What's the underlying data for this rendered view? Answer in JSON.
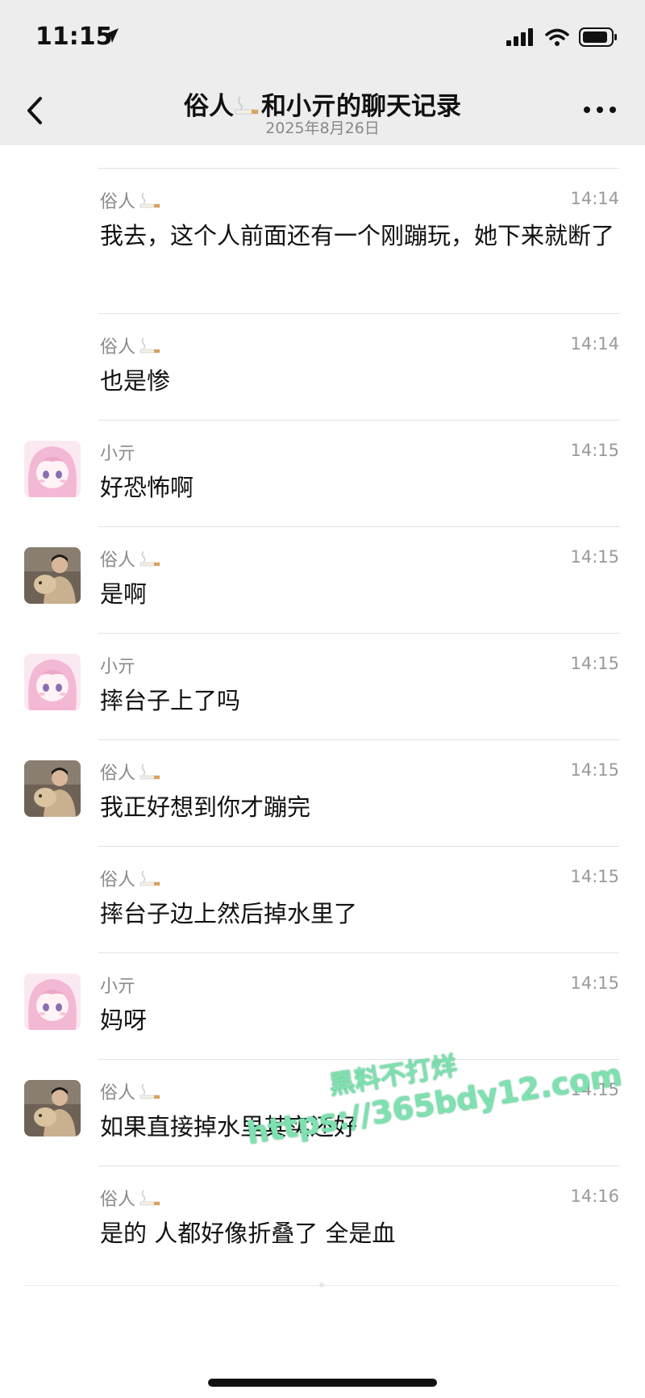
{
  "status_bar": {
    "time": "11:15"
  },
  "header": {
    "title_part1": "俗人",
    "title_part2": "和小亓的聊天记录",
    "date": "2025年8月26日"
  },
  "messages": [
    {
      "sender": "俗人",
      "emoji": true,
      "avatar": "none",
      "time": "14:14",
      "text": "我去，这个人前面还有一个刚蹦玩，她下来就断了"
    },
    {
      "sender": "俗人",
      "emoji": true,
      "avatar": "none",
      "time": "14:14",
      "text": "也是惨"
    },
    {
      "sender": "小亓",
      "emoji": false,
      "avatar": "anime",
      "time": "14:15",
      "text": "好恐怖啊"
    },
    {
      "sender": "俗人",
      "emoji": true,
      "avatar": "photo",
      "time": "14:15",
      "text": "是啊"
    },
    {
      "sender": "小亓",
      "emoji": false,
      "avatar": "anime",
      "time": "14:15",
      "text": "摔台子上了吗"
    },
    {
      "sender": "俗人",
      "emoji": true,
      "avatar": "photo",
      "time": "14:15",
      "text": "我正好想到你才蹦完"
    },
    {
      "sender": "俗人",
      "emoji": true,
      "avatar": "none",
      "time": "14:15",
      "text": "摔台子边上然后掉水里了"
    },
    {
      "sender": "小亓",
      "emoji": false,
      "avatar": "anime",
      "time": "14:15",
      "text": "妈呀"
    },
    {
      "sender": "俗人",
      "emoji": true,
      "avatar": "photo",
      "time": "14:15",
      "text": "如果直接掉水里其实还好"
    },
    {
      "sender": "俗人",
      "emoji": true,
      "avatar": "none",
      "time": "14:16",
      "text": "是的 人都好像折叠了 全是血"
    }
  ],
  "watermark": {
    "line1": "黑料不打烊",
    "line2": "https://365bdy12.com"
  }
}
